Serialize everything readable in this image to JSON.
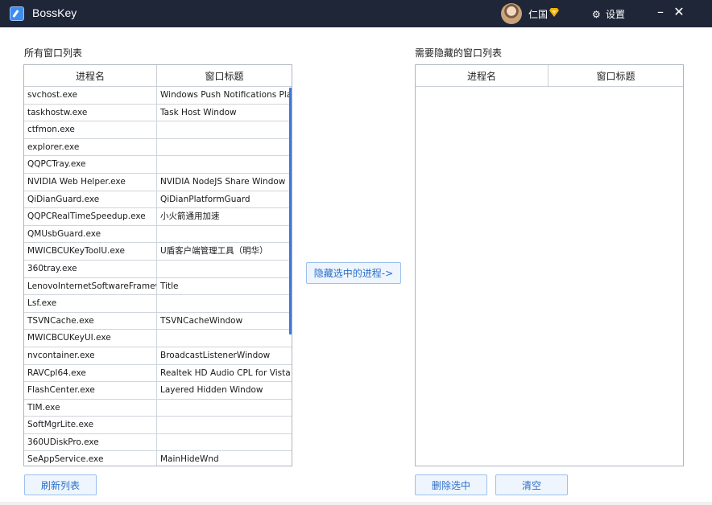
{
  "app": {
    "title": "BossKey"
  },
  "user": {
    "name": "仁国"
  },
  "header": {
    "settings_label": "设置",
    "minimize_label": "–",
    "close_label": "✕"
  },
  "left_panel": {
    "title": "所有窗口列表",
    "columns": [
      "进程名",
      "窗口标题"
    ],
    "rows": [
      {
        "process": "svchost.exe",
        "title": "Windows Push Notifications Platfor"
      },
      {
        "process": "taskhostw.exe",
        "title": "Task Host Window"
      },
      {
        "process": "ctfmon.exe",
        "title": ""
      },
      {
        "process": "explorer.exe",
        "title": ""
      },
      {
        "process": "QQPCTray.exe",
        "title": ""
      },
      {
        "process": "NVIDIA Web Helper.exe",
        "title": "NVIDIA NodeJS Share Window"
      },
      {
        "process": "QiDianGuard.exe",
        "title": "QiDianPlatformGuard"
      },
      {
        "process": "QQPCRealTimeSpeedup.exe",
        "title": "小火箭通用加速"
      },
      {
        "process": "QMUsbGuard.exe",
        "title": ""
      },
      {
        "process": "MWICBCUKeyToolU.exe",
        "title": "U盾客户端管理工具（明华）"
      },
      {
        "process": "360tray.exe",
        "title": ""
      },
      {
        "process": "LenovoInternetSoftwareFramework",
        "title": "Title"
      },
      {
        "process": "Lsf.exe",
        "title": ""
      },
      {
        "process": "TSVNCache.exe",
        "title": "TSVNCacheWindow"
      },
      {
        "process": "MWICBCUKeyUI.exe",
        "title": ""
      },
      {
        "process": "nvcontainer.exe",
        "title": "BroadcastListenerWindow"
      },
      {
        "process": "RAVCpl64.exe",
        "title": "Realtek HD Audio CPL for Vista"
      },
      {
        "process": "FlashCenter.exe",
        "title": "Layered Hidden Window"
      },
      {
        "process": "TIM.exe",
        "title": ""
      },
      {
        "process": "SoftMgrLite.exe",
        "title": ""
      },
      {
        "process": "360UDiskPro.exe",
        "title": ""
      },
      {
        "process": "SeAppService.exe",
        "title": "MainHideWnd"
      }
    ],
    "refresh_label": "刷新列表"
  },
  "middle": {
    "hide_selected_label": "隐藏选中的进程->"
  },
  "right_panel": {
    "title": "需要隐藏的窗口列表",
    "columns": [
      "进程名",
      "窗口标题"
    ],
    "rows": [],
    "remove_selected_label": "删除选中",
    "clear_label": "清空"
  },
  "colors": {
    "titlebar": "#1f2637",
    "accent": "#3d8cf0",
    "button_border": "#9cc0ee",
    "button_text": "#2a6fc9",
    "vip": "#f5b400"
  }
}
